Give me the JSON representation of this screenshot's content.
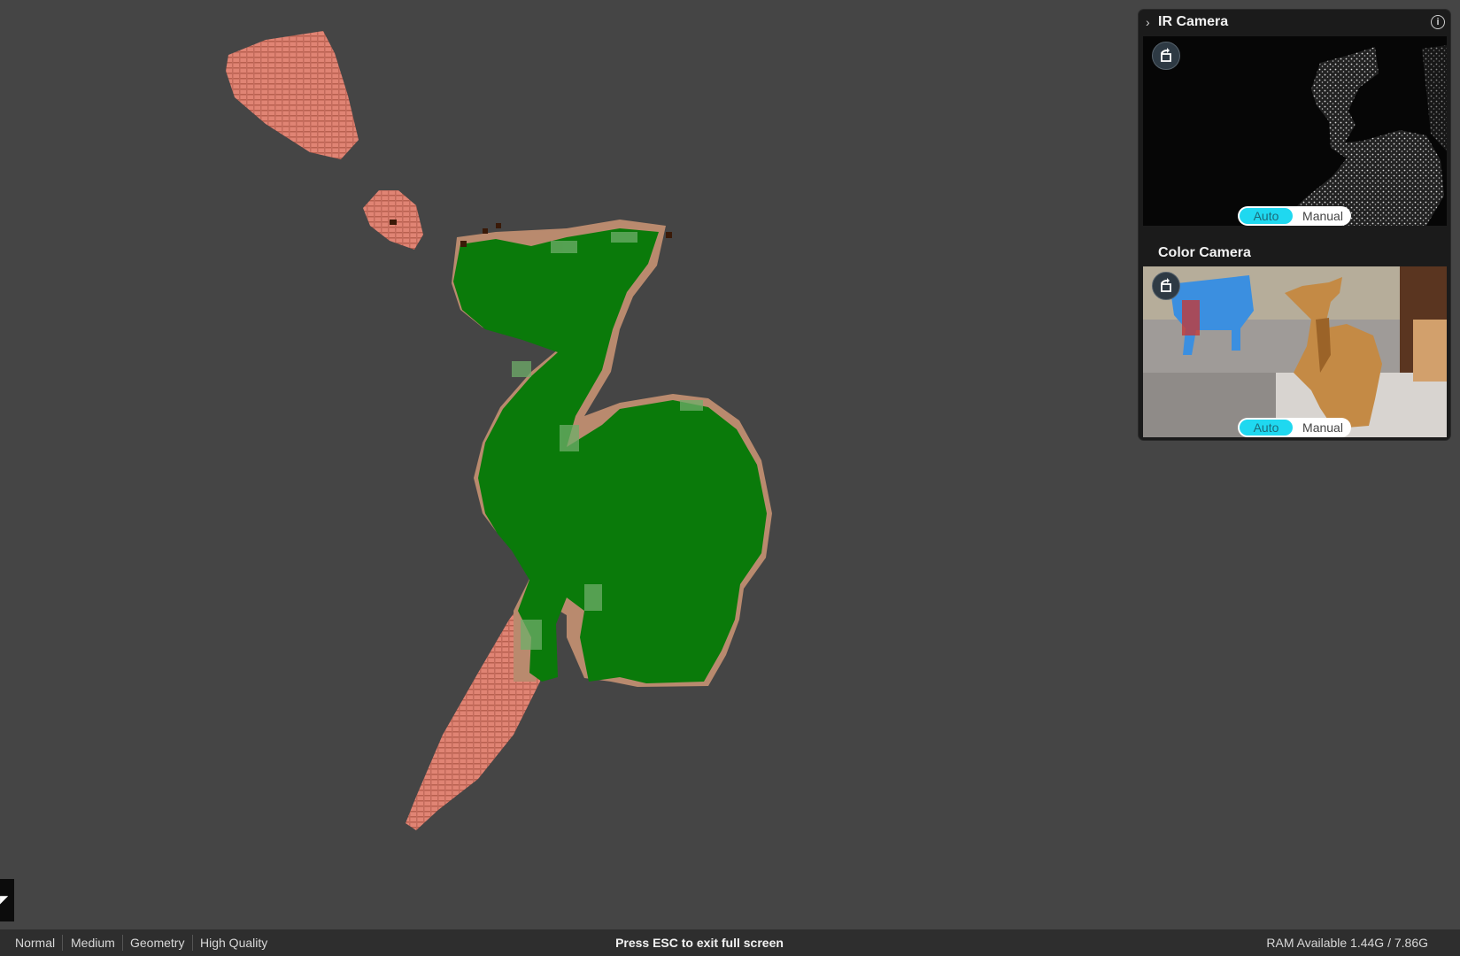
{
  "status_bar": {
    "modes": [
      "Normal",
      "Medium",
      "Geometry",
      "High Quality"
    ],
    "esc_hint": "Press ESC to exit full screen",
    "ram": "RAM Available 1.44G / 7.86G"
  },
  "ir_camera": {
    "title": "IR Camera",
    "toggle": {
      "auto": "Auto",
      "manual": "Manual",
      "selected": "Auto"
    }
  },
  "color_camera": {
    "title": "Color Camera",
    "toggle": {
      "auto": "Auto",
      "manual": "Manual",
      "selected": "Auto"
    }
  },
  "icons": {
    "panel_collapse": "chevron-right-icon",
    "info": "info-icon",
    "rotate": "rotate-icon"
  },
  "colors": {
    "background": "#454545",
    "scanned_mesh": "#0a7a0a",
    "point_cloud": "#e08474",
    "toggle_active": "#1fd8f0"
  }
}
